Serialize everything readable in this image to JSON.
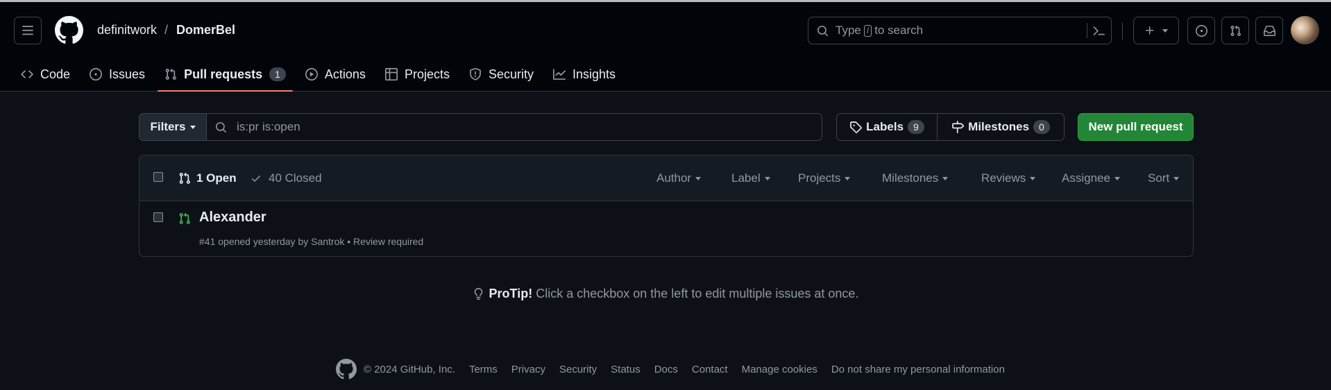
{
  "header": {
    "owner": "definitwork",
    "separator": "/",
    "repo": "DomerBel",
    "search_prefix": "Type",
    "search_key": "/",
    "search_suffix": "to search"
  },
  "tabs": [
    {
      "label": "Code"
    },
    {
      "label": "Issues"
    },
    {
      "label": "Pull requests",
      "count": "1"
    },
    {
      "label": "Actions"
    },
    {
      "label": "Projects"
    },
    {
      "label": "Security"
    },
    {
      "label": "Insights"
    }
  ],
  "filters": {
    "filters_label": "Filters",
    "query": "is:pr is:open",
    "labels_label": "Labels",
    "labels_count": "9",
    "milestones_label": "Milestones",
    "milestones_count": "0",
    "new_pr_label": "New pull request"
  },
  "list_header": {
    "open": "1 Open",
    "closed": "40 Closed",
    "menus": [
      "Author",
      "Label",
      "Projects",
      "Milestones",
      "Reviews",
      "Assignee",
      "Sort"
    ]
  },
  "pull_requests": [
    {
      "title": "Alexander",
      "meta": "#41 opened yesterday by Santrok • Review required"
    }
  ],
  "protip": {
    "bold": "ProTip!",
    "text": "Click a checkbox on the left to edit multiple issues at once."
  },
  "footer": {
    "copyright": "© 2024 GitHub, Inc.",
    "links": [
      "Terms",
      "Privacy",
      "Security",
      "Status",
      "Docs",
      "Contact",
      "Manage cookies",
      "Do not share my personal information"
    ]
  },
  "colors": {
    "background": "#0d1117",
    "header_bg": "#010409",
    "accent_underline": "#f78166",
    "primary_button": "#238636",
    "open_pr_icon": "#3fb950"
  }
}
